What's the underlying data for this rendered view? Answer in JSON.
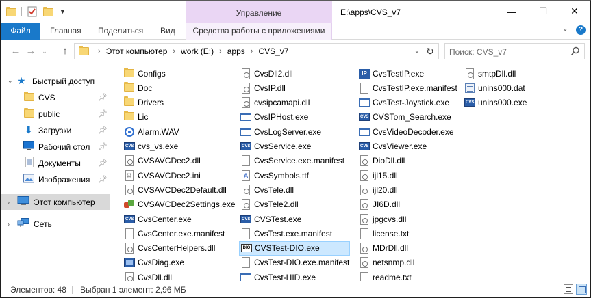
{
  "window": {
    "title": "E:\\apps\\CVS_v7",
    "context_tab_group": "Управление",
    "controls": {
      "minimize": "—",
      "maximize": "☐",
      "close": "✕"
    }
  },
  "ribbon": {
    "file_tab": "Файл",
    "tabs": [
      "Главная",
      "Поделиться",
      "Вид"
    ],
    "context_tab": "Средства работы с приложениями",
    "help": "?"
  },
  "address": {
    "crumbs": [
      "Этот компьютер",
      "work (E:)",
      "apps",
      "CVS_v7"
    ],
    "search_placeholder": "Поиск: CVS_v7"
  },
  "nav_pane": {
    "quick_access": "Быстрый доступ",
    "pinned": [
      "CVS",
      "public",
      "Загрузки",
      "Рабочий стол",
      "Документы",
      "Изображения"
    ],
    "this_pc": "Этот компьютер",
    "network": "Сеть"
  },
  "files": {
    "col1": [
      {
        "name": "Configs",
        "icon": "folder-icon"
      },
      {
        "name": "Doc",
        "icon": "folder-icon"
      },
      {
        "name": "Drivers",
        "icon": "folder-icon"
      },
      {
        "name": "Lic",
        "icon": "folder-icon"
      },
      {
        "name": "Alarm.WAV",
        "icon": "audio-file-icon"
      },
      {
        "name": "cvs_vs.exe",
        "icon": "cvs-app-icon"
      },
      {
        "name": "CVSAVCDec2.dll",
        "icon": "dll-file-icon"
      },
      {
        "name": "CVSAVCDec2.ini",
        "icon": "ini-file-icon"
      },
      {
        "name": "CVSAVCDec2Default.dll",
        "icon": "dll-file-icon"
      },
      {
        "name": "CVSAVCDec2Settings.exe",
        "icon": "setup-app-icon"
      },
      {
        "name": "CvsCenter.exe",
        "icon": "cvs-app-icon"
      },
      {
        "name": "CvsCenter.exe.manifest",
        "icon": "document-icon"
      },
      {
        "name": "CvsCenterHelpers.dll",
        "icon": "dll-file-icon"
      },
      {
        "name": "CvsDiag.exe",
        "icon": "diag-app-icon"
      },
      {
        "name": "CvsDll.dll",
        "icon": "dll-file-icon"
      }
    ],
    "col2": [
      {
        "name": "CvsDll2.dll",
        "icon": "dll-file-icon"
      },
      {
        "name": "CvsIP.dll",
        "icon": "dll-file-icon"
      },
      {
        "name": "cvsipcamapi.dll",
        "icon": "dll-file-icon"
      },
      {
        "name": "CvsIPHost.exe",
        "icon": "window-app-icon"
      },
      {
        "name": "CvsLogServer.exe",
        "icon": "window-app-icon"
      },
      {
        "name": "CvsService.exe",
        "icon": "cvs-app-icon"
      },
      {
        "name": "CvsService.exe.manifest",
        "icon": "document-icon"
      },
      {
        "name": "CvsSymbols.ttf",
        "icon": "font-file-icon"
      },
      {
        "name": "CvsTele.dll",
        "icon": "dll-file-icon"
      },
      {
        "name": "CvsTele2.dll",
        "icon": "dll-file-icon"
      },
      {
        "name": "CVSTest.exe",
        "icon": "cvs-app-icon"
      },
      {
        "name": "CvsTest.exe.manifest",
        "icon": "document-icon"
      },
      {
        "name": "CVSTest-DIO.exe",
        "icon": "dio-app-icon"
      },
      {
        "name": "CvsTest-DIO.exe.manifest",
        "icon": "document-icon"
      },
      {
        "name": "CvsTest-HID.exe",
        "icon": "window-app-icon"
      }
    ],
    "col3": [
      {
        "name": "CvsTestIP.exe",
        "icon": "ip-app-icon"
      },
      {
        "name": "CvsTestIP.exe.manifest",
        "icon": "document-icon"
      },
      {
        "name": "CvsTest-Joystick.exe",
        "icon": "window-app-icon"
      },
      {
        "name": "CVSTom_Search.exe",
        "icon": "cvs-app-icon"
      },
      {
        "name": "CvsVideoDecoder.exe",
        "icon": "window-app-icon"
      },
      {
        "name": "CvsViewer.exe",
        "icon": "cvs-app-icon"
      },
      {
        "name": "DioDll.dll",
        "icon": "dll-file-icon"
      },
      {
        "name": "ijl15.dll",
        "icon": "dll-file-icon"
      },
      {
        "name": "ijl20.dll",
        "icon": "dll-file-icon"
      },
      {
        "name": "JI6D.dll",
        "icon": "dll-file-icon"
      },
      {
        "name": "jpgcvs.dll",
        "icon": "dll-file-icon"
      },
      {
        "name": "license.txt",
        "icon": "document-icon"
      },
      {
        "name": "MDrDll.dll",
        "icon": "dll-file-icon"
      },
      {
        "name": "netsnmp.dll",
        "icon": "dll-file-icon"
      },
      {
        "name": "readme.txt",
        "icon": "document-icon"
      }
    ],
    "col4": [
      {
        "name": "smtpDll.dll",
        "icon": "dll-file-icon"
      },
      {
        "name": "unins000.dat",
        "icon": "dat-file-icon"
      },
      {
        "name": "unins000.exe",
        "icon": "cvs-app-icon"
      }
    ],
    "selected": "CVSTest-DIO.exe"
  },
  "status": {
    "count": "Элементов: 48",
    "selection": "Выбран 1 элемент: 2,96 МБ"
  },
  "colors": {
    "accent": "#1979ca",
    "context_tab": "#ead6f4",
    "selection": "#cce8ff",
    "folder": "#f8d775"
  }
}
